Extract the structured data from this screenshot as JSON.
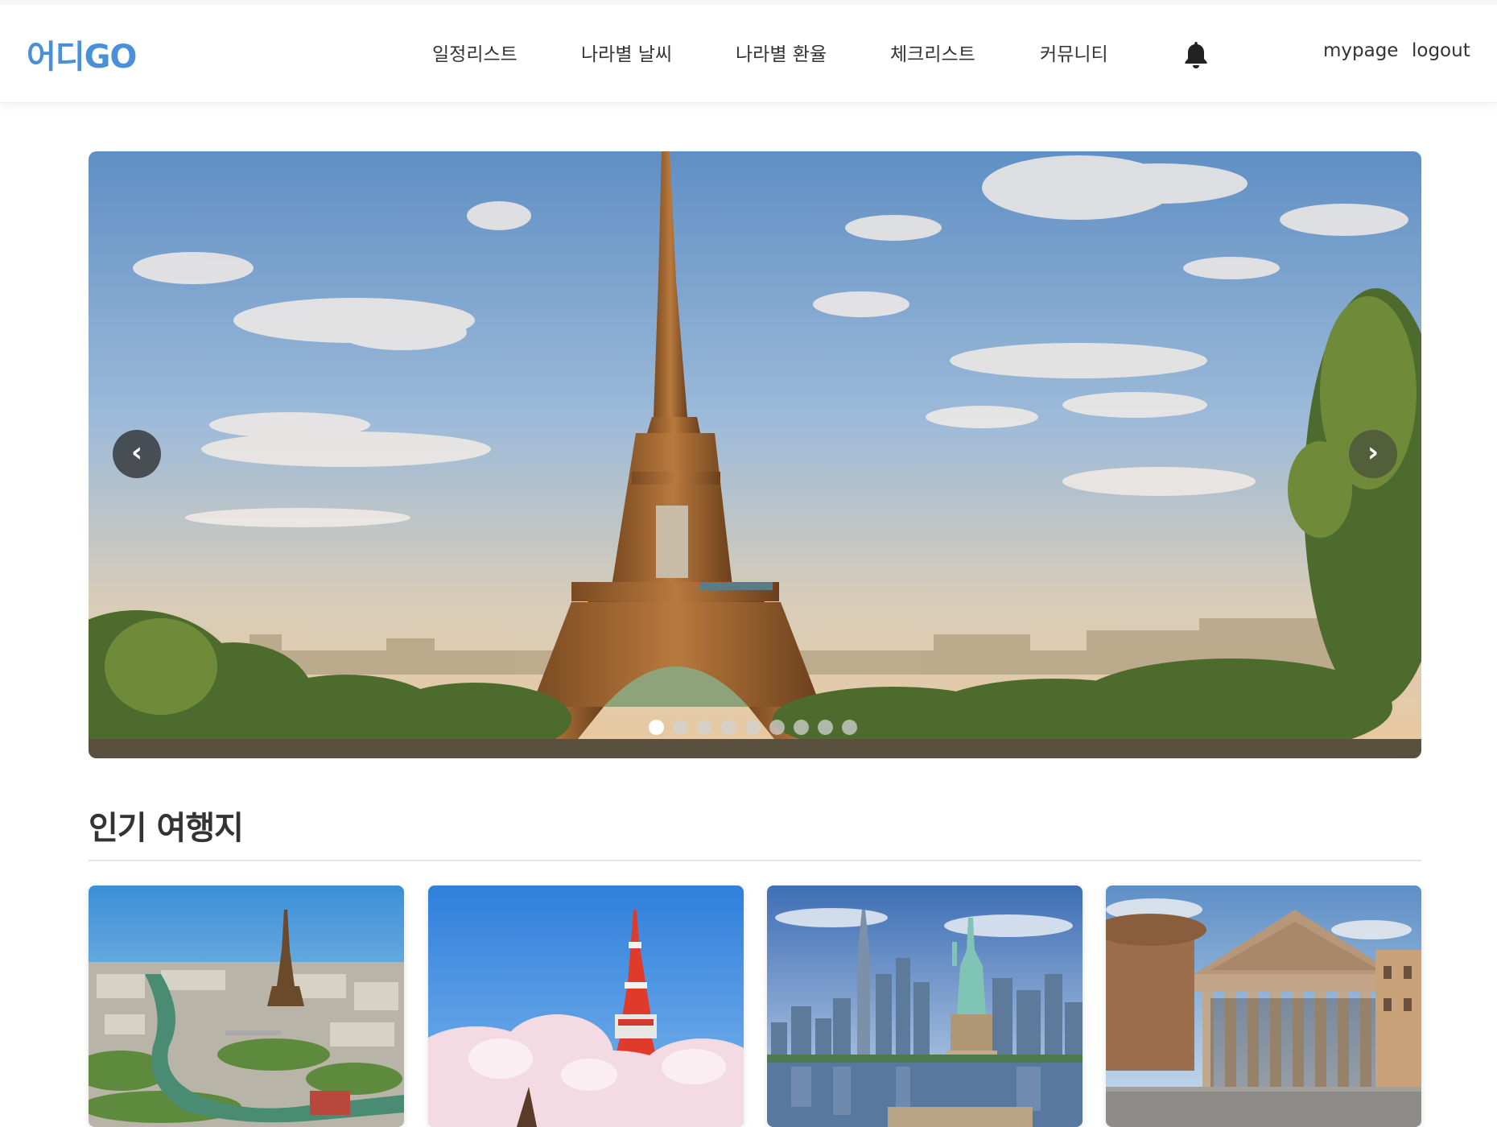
{
  "header": {
    "logo": "어디GO",
    "nav": [
      {
        "label": "일정리스트"
      },
      {
        "label": "나라별 날씨"
      },
      {
        "label": "나라별 환율"
      },
      {
        "label": "체크리스트"
      },
      {
        "label": "커뮤니티"
      }
    ],
    "notification_icon": "bell-icon",
    "mypage": "mypage",
    "logout": "logout"
  },
  "carousel": {
    "prev_label": "‹",
    "next_label": "›",
    "slide_count": 9,
    "active_index": 0,
    "current_slide": "eiffel-tower"
  },
  "popular": {
    "title": "인기 여행지",
    "cards": [
      {
        "image": "paris-eiffel-tower"
      },
      {
        "image": "tokyo-tower-cherry-blossom"
      },
      {
        "image": "new-york-statue-of-liberty"
      },
      {
        "image": "rome-pantheon"
      }
    ]
  },
  "colors": {
    "brand": "#4a90d9",
    "text": "#333333"
  }
}
